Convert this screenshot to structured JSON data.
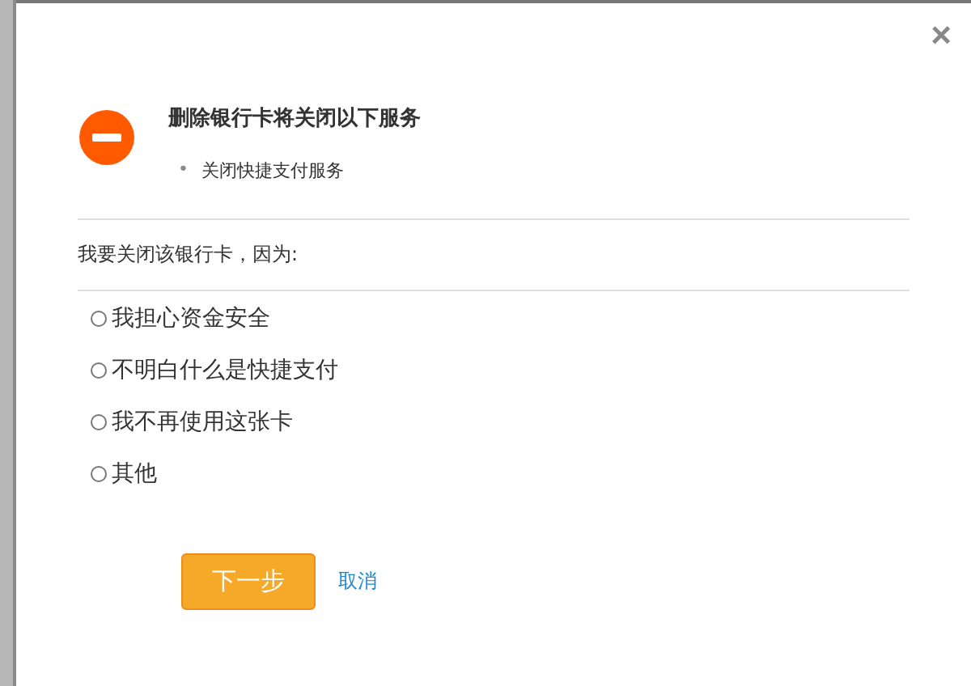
{
  "dialog": {
    "close": "×",
    "title": "删除银行卡将关闭以下服务",
    "services": [
      {
        "bullet": "•",
        "text": "关闭快捷支付服务"
      }
    ],
    "prompt": "我要关闭该银行卡，因为:",
    "reasons": [
      {
        "label": "我担心资金安全",
        "selected": false
      },
      {
        "label": "不明白什么是快捷支付",
        "selected": false
      },
      {
        "label": "我不再使用这张卡",
        "selected": false
      },
      {
        "label": "其他",
        "selected": false
      }
    ],
    "next_button": "下一步",
    "cancel_link": "取消"
  }
}
